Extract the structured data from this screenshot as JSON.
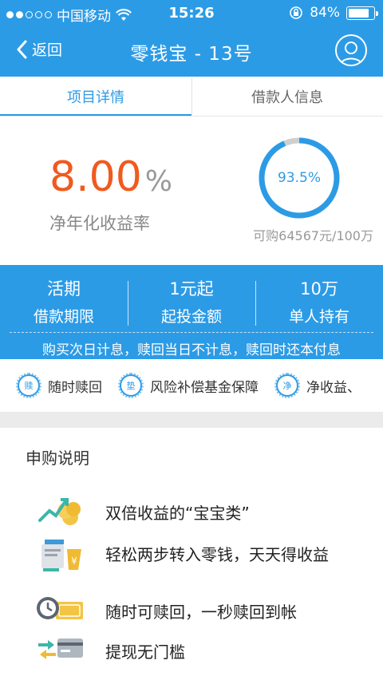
{
  "status": {
    "carrier": "中国移动",
    "time": "15:26",
    "battery": "84%",
    "battery_level": 0.84
  },
  "nav": {
    "back_label": "返回",
    "title": "零钱宝 - 13号"
  },
  "tabs": [
    {
      "label": "项目详情",
      "active": true
    },
    {
      "label": "借款人信息",
      "active": false
    }
  ],
  "rate": {
    "value": "8.00",
    "unit": "%",
    "label": "净年化收益率",
    "progress_text": "93.5%",
    "progress": 0.935,
    "available": "可购64567元/100万"
  },
  "terms": [
    {
      "value": "活期",
      "label": "借款期限"
    },
    {
      "value": "1元起",
      "label": "起投金额"
    },
    {
      "value": "10万",
      "label": "单人持有"
    }
  ],
  "terms_note": "购买次日计息，赎回当日不计息，赎回时还本付息",
  "features": [
    {
      "icon": "赎",
      "label": "随时赎回"
    },
    {
      "icon": "垫",
      "label": "风险补偿基金保障"
    },
    {
      "icon": "净",
      "label": "净收益、"
    }
  ],
  "subscription": {
    "title": "申购说明",
    "items": [
      {
        "icon": "growth-coins-icon",
        "text": "双倍收益的“宝宝类”"
      },
      {
        "icon": "transfer-money-icon",
        "text": "轻松两步转入零钱，天天得收益"
      },
      {
        "icon": "clock-cash-icon",
        "text": "随时可赎回，一秒赎回到帐"
      },
      {
        "icon": "card-exchange-icon",
        "text": "提现无门槛"
      }
    ]
  },
  "colors": {
    "brand": "#2c9be6",
    "rate": "#f05a1e"
  }
}
